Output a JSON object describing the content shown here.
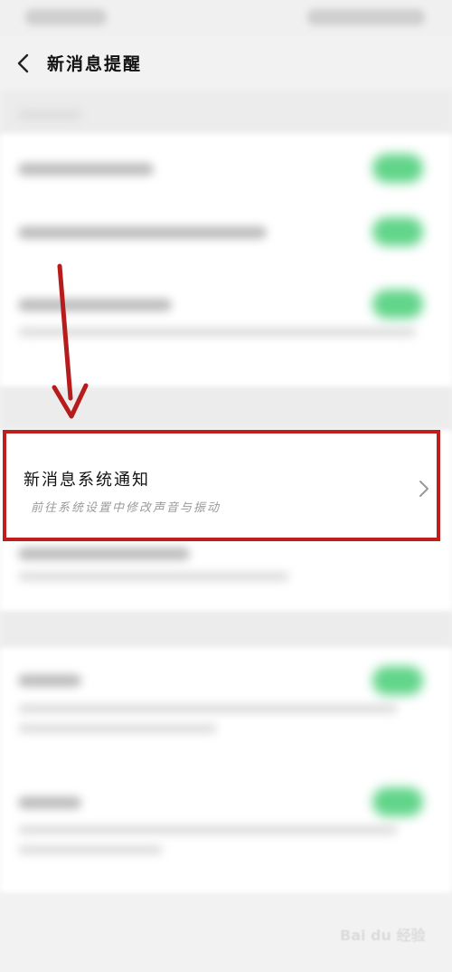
{
  "header": {
    "title": "新消息提醒"
  },
  "notification_row": {
    "title": "新消息系统通知",
    "subtitle": "前往系统设置中修改声音与振动"
  },
  "colors": {
    "highlight": "#c01d1d",
    "toggle_on": "#62d58a",
    "background": "#f2f2f2"
  },
  "watermark": {
    "logo_text": "Bai du 经验"
  },
  "icons": {
    "back": "back-icon",
    "chevron": "chevron-right-icon",
    "arrow": "down-arrow-icon"
  }
}
